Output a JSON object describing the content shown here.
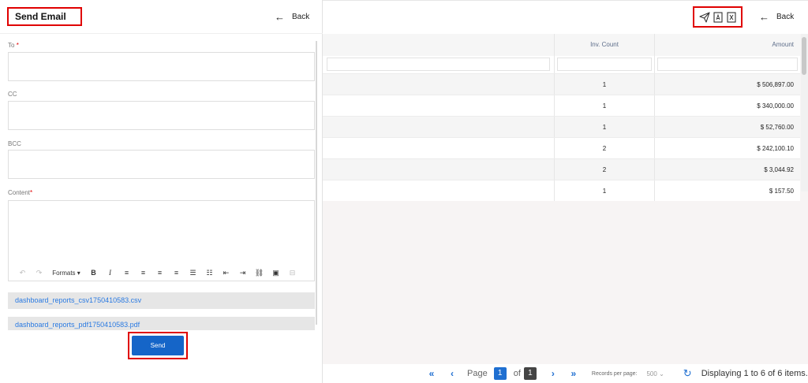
{
  "modal": {
    "title": "Send Email",
    "back_label": "Back",
    "to_label": "To",
    "cc_label": "CC",
    "bcc_label": "BCC",
    "content_label": "Content",
    "required_mark": "*",
    "toolbar": {
      "formats_label": "Formats"
    },
    "attachments": [
      "dashboard_reports_csv1750410583.csv",
      "dashboard_reports_pdf1750410583.pdf"
    ],
    "send_label": "Send"
  },
  "background": {
    "back_label": "Back",
    "toolbar_icons": [
      "send-icon",
      "pdf-icon",
      "excel-icon"
    ],
    "table": {
      "columns": [
        "",
        "Inv. Count",
        "Amount"
      ],
      "rows": [
        {
          "count": "1",
          "amount": "$ 506,897.00"
        },
        {
          "count": "1",
          "amount": "$ 340,000.00"
        },
        {
          "count": "1",
          "amount": "$ 52,760.00"
        },
        {
          "count": "2",
          "amount": "$ 242,100.10"
        },
        {
          "count": "2",
          "amount": "$ 3,044.92"
        },
        {
          "count": "1",
          "amount": "$ 157.50"
        }
      ]
    },
    "pager": {
      "page_label": "Page",
      "current_page": "1",
      "of_label": "of",
      "total_pages": "1",
      "records_per_page_label": "Records per page:",
      "records_per_page": "500",
      "display_text": "Displaying 1 to 6 of 6 items."
    }
  },
  "colors": {
    "accent": "#1565c8",
    "highlight": "#e00000",
    "link": "#2a7ae2"
  }
}
